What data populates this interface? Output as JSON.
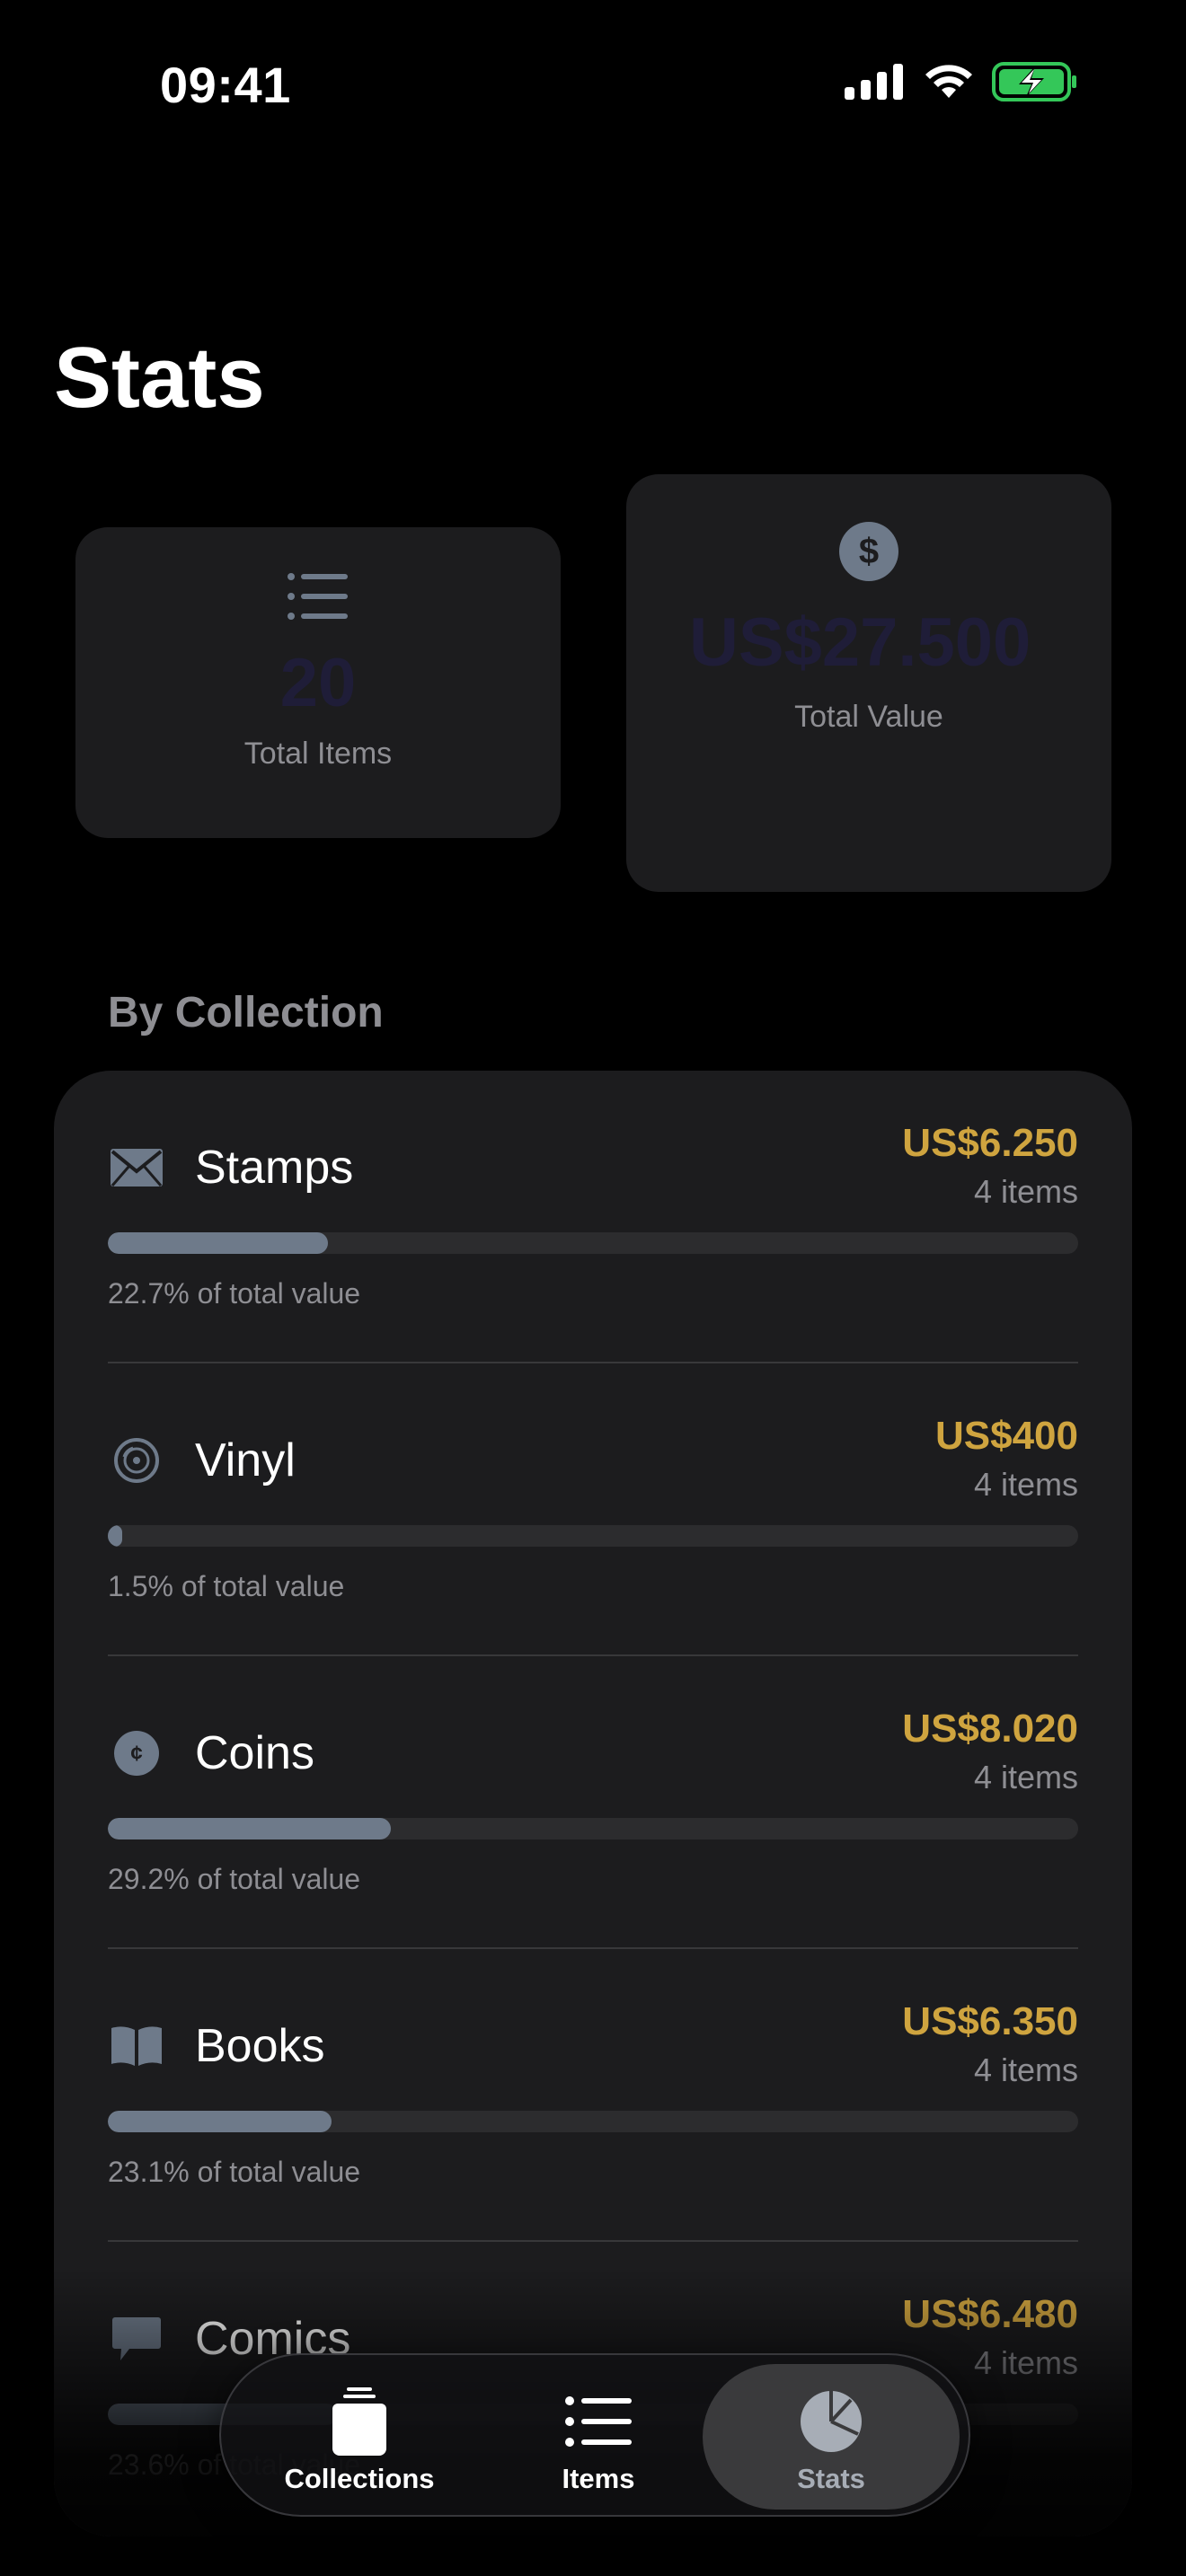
{
  "status_bar": {
    "time": "09:41"
  },
  "page_title": "Stats",
  "summary": {
    "total_items": {
      "value": "20",
      "label": "Total Items",
      "icon": "list-icon"
    },
    "total_value": {
      "value": "US$27.500",
      "label": "Total Value",
      "icon": "dollar-circle-icon"
    }
  },
  "section_title": "By Collection",
  "collections": [
    {
      "name": "Stamps",
      "value": "US$6.250",
      "count": "4 items",
      "percent_text": "22.7% of total value",
      "share": 0.227,
      "icon": "envelope-icon"
    },
    {
      "name": "Vinyl",
      "value": "US$400",
      "count": "4 items",
      "percent_text": "1.5% of total value",
      "share": 0.015,
      "icon": "record-icon"
    },
    {
      "name": "Coins",
      "value": "US$8.020",
      "count": "4 items",
      "percent_text": "29.2% of total value",
      "share": 0.292,
      "icon": "coin-icon"
    },
    {
      "name": "Books",
      "value": "US$6.350",
      "count": "4 items",
      "percent_text": "23.1% of total value",
      "share": 0.231,
      "icon": "book-icon"
    },
    {
      "name": "Comics",
      "value": "US$6.480",
      "count": "4 items",
      "percent_text": "23.6% of total value",
      "share": 0.236,
      "icon": "speech-bubble-icon"
    }
  ],
  "tab_bar": {
    "tabs": [
      {
        "label": "Collections",
        "icon": "jar-icon",
        "selected": false
      },
      {
        "label": "Items",
        "icon": "list-icon",
        "selected": false
      },
      {
        "label": "Stats",
        "icon": "pie-chart-icon",
        "selected": true
      }
    ]
  },
  "colors": {
    "accent_value": "#cfa43f",
    "bar_fill": "#6e7a8a",
    "battery": "#34c759"
  }
}
